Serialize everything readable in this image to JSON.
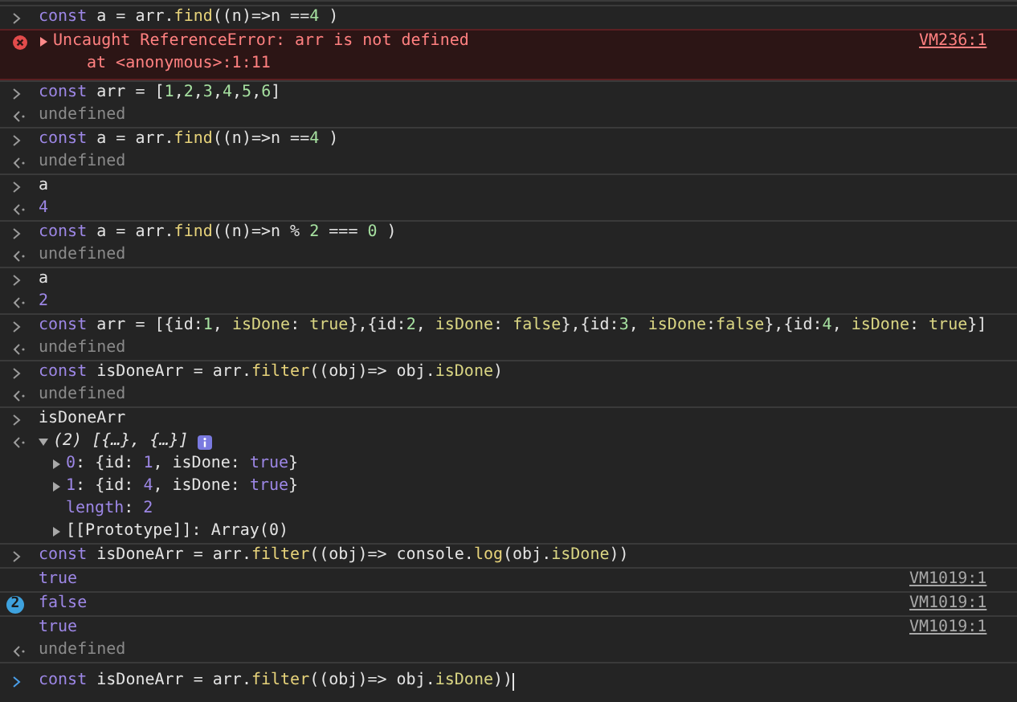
{
  "entries": [
    {
      "kind": "input",
      "tokens": [
        {
          "t": "const",
          "kind": "keyword"
        },
        {
          "t": " a = arr.",
          "kind": "plain"
        },
        {
          "t": "find",
          "kind": "function"
        },
        {
          "t": "((n)=>n ==",
          "kind": "plain"
        },
        {
          "t": "4",
          "kind": "number"
        },
        {
          "t": " )",
          "kind": "plain"
        }
      ]
    },
    {
      "kind": "error",
      "expanded": false,
      "message": "Uncaught ReferenceError: arr is not defined",
      "stack": "at <anonymous>:1:11",
      "source": "VM236:1"
    },
    {
      "kind": "input",
      "tokens": [
        {
          "t": "const",
          "kind": "keyword"
        },
        {
          "t": " arr = [",
          "kind": "plain"
        },
        {
          "t": "1",
          "kind": "number"
        },
        {
          "t": ",",
          "kind": "plain"
        },
        {
          "t": "2",
          "kind": "number"
        },
        {
          "t": ",",
          "kind": "plain"
        },
        {
          "t": "3",
          "kind": "number"
        },
        {
          "t": ",",
          "kind": "plain"
        },
        {
          "t": "4",
          "kind": "number"
        },
        {
          "t": ",",
          "kind": "plain"
        },
        {
          "t": "5",
          "kind": "number"
        },
        {
          "t": ",",
          "kind": "plain"
        },
        {
          "t": "6",
          "kind": "number"
        },
        {
          "t": "]",
          "kind": "plain"
        }
      ]
    },
    {
      "kind": "result",
      "tokens": [
        {
          "t": "undefined",
          "kind": "undefined"
        }
      ]
    },
    {
      "kind": "input",
      "tokens": [
        {
          "t": "const",
          "kind": "keyword"
        },
        {
          "t": " a = arr.",
          "kind": "plain"
        },
        {
          "t": "find",
          "kind": "function"
        },
        {
          "t": "((n)=>n ==",
          "kind": "plain"
        },
        {
          "t": "4",
          "kind": "number"
        },
        {
          "t": " )",
          "kind": "plain"
        }
      ]
    },
    {
      "kind": "result",
      "tokens": [
        {
          "t": "undefined",
          "kind": "undefined"
        }
      ]
    },
    {
      "kind": "input",
      "tokens": [
        {
          "t": "a",
          "kind": "plain"
        }
      ]
    },
    {
      "kind": "result",
      "tokens": [
        {
          "t": "4",
          "kind": "value"
        }
      ]
    },
    {
      "kind": "input",
      "tokens": [
        {
          "t": "const",
          "kind": "keyword"
        },
        {
          "t": " a = arr.",
          "kind": "plain"
        },
        {
          "t": "find",
          "kind": "function"
        },
        {
          "t": "((n)=>n % ",
          "kind": "plain"
        },
        {
          "t": "2",
          "kind": "number"
        },
        {
          "t": " === ",
          "kind": "plain"
        },
        {
          "t": "0",
          "kind": "number"
        },
        {
          "t": " )",
          "kind": "plain"
        }
      ]
    },
    {
      "kind": "result",
      "tokens": [
        {
          "t": "undefined",
          "kind": "undefined"
        }
      ]
    },
    {
      "kind": "input",
      "tokens": [
        {
          "t": "a",
          "kind": "plain"
        }
      ]
    },
    {
      "kind": "result",
      "tokens": [
        {
          "t": "2",
          "kind": "value"
        }
      ]
    },
    {
      "kind": "input",
      "tokens": [
        {
          "t": "const",
          "kind": "keyword"
        },
        {
          "t": " arr = [{id:",
          "kind": "plain"
        },
        {
          "t": "1",
          "kind": "number"
        },
        {
          "t": ", ",
          "kind": "plain"
        },
        {
          "t": "isDone",
          "kind": "property"
        },
        {
          "t": ": ",
          "kind": "plain"
        },
        {
          "t": "true",
          "kind": "boolean"
        },
        {
          "t": "},{id:",
          "kind": "plain"
        },
        {
          "t": "2",
          "kind": "number"
        },
        {
          "t": ", ",
          "kind": "plain"
        },
        {
          "t": "isDone",
          "kind": "property"
        },
        {
          "t": ": ",
          "kind": "plain"
        },
        {
          "t": "false",
          "kind": "boolean"
        },
        {
          "t": "},{id:",
          "kind": "plain"
        },
        {
          "t": "3",
          "kind": "number"
        },
        {
          "t": ", ",
          "kind": "plain"
        },
        {
          "t": "isDone",
          "kind": "property"
        },
        {
          "t": ":",
          "kind": "plain"
        },
        {
          "t": "false",
          "kind": "boolean"
        },
        {
          "t": "},{id:",
          "kind": "plain"
        },
        {
          "t": "4",
          "kind": "number"
        },
        {
          "t": ", ",
          "kind": "plain"
        },
        {
          "t": "isDone",
          "kind": "property"
        },
        {
          "t": ": ",
          "kind": "plain"
        },
        {
          "t": "true",
          "kind": "boolean"
        },
        {
          "t": "}]",
          "kind": "plain"
        }
      ]
    },
    {
      "kind": "result",
      "tokens": [
        {
          "t": "undefined",
          "kind": "undefined"
        }
      ]
    },
    {
      "kind": "input",
      "tokens": [
        {
          "t": "const",
          "kind": "keyword"
        },
        {
          "t": " isDoneArr = arr.",
          "kind": "plain"
        },
        {
          "t": "filter",
          "kind": "function"
        },
        {
          "t": "((obj)=> obj.",
          "kind": "plain"
        },
        {
          "t": "isDone",
          "kind": "property"
        },
        {
          "t": ")",
          "kind": "plain"
        }
      ]
    },
    {
      "kind": "result",
      "tokens": [
        {
          "t": "undefined",
          "kind": "undefined"
        }
      ]
    },
    {
      "kind": "input",
      "tokens": [
        {
          "t": "isDoneArr",
          "kind": "plain"
        }
      ]
    },
    {
      "kind": "object",
      "expanded": true,
      "summary": "(2) [{…}, {…}]",
      "children": [
        {
          "expandable": true,
          "tokens": [
            {
              "t": "0",
              "kind": "value"
            },
            {
              "t": ": {id: ",
              "kind": "plain"
            },
            {
              "t": "1",
              "kind": "value"
            },
            {
              "t": ", isDone: ",
              "kind": "plain"
            },
            {
              "t": "true",
              "kind": "value"
            },
            {
              "t": "}",
              "kind": "plain"
            }
          ]
        },
        {
          "expandable": true,
          "tokens": [
            {
              "t": "1",
              "kind": "value"
            },
            {
              "t": ": {id: ",
              "kind": "plain"
            },
            {
              "t": "4",
              "kind": "value"
            },
            {
              "t": ", isDone: ",
              "kind": "plain"
            },
            {
              "t": "true",
              "kind": "value"
            },
            {
              "t": "}",
              "kind": "plain"
            }
          ]
        },
        {
          "expandable": false,
          "tokens": [
            {
              "t": "length",
              "kind": "value"
            },
            {
              "t": ": ",
              "kind": "plain"
            },
            {
              "t": "2",
              "kind": "value"
            }
          ]
        },
        {
          "expandable": true,
          "tokens": [
            {
              "t": "[[Prototype]]",
              "kind": "plain"
            },
            {
              "t": ": Array(0)",
              "kind": "plain"
            }
          ]
        }
      ]
    },
    {
      "kind": "input",
      "tokens": [
        {
          "t": "const",
          "kind": "keyword"
        },
        {
          "t": " isDoneArr = arr.",
          "kind": "plain"
        },
        {
          "t": "filter",
          "kind": "function"
        },
        {
          "t": "((obj)=> console.",
          "kind": "plain"
        },
        {
          "t": "log",
          "kind": "function"
        },
        {
          "t": "(obj.",
          "kind": "plain"
        },
        {
          "t": "isDone",
          "kind": "property"
        },
        {
          "t": "))",
          "kind": "plain"
        }
      ]
    },
    {
      "kind": "log",
      "text": "true",
      "source": "VM1019:1"
    },
    {
      "kind": "log",
      "count": "2",
      "text": "false",
      "source": "VM1019:1"
    },
    {
      "kind": "log",
      "text": "true",
      "source": "VM1019:1"
    },
    {
      "kind": "result",
      "tokens": [
        {
          "t": "undefined",
          "kind": "undefined"
        }
      ]
    }
  ],
  "prompt": {
    "tokens": [
      {
        "t": "const",
        "kind": "keyword"
      },
      {
        "t": " isDoneArr = arr.",
        "kind": "plain"
      },
      {
        "t": "filter",
        "kind": "function"
      },
      {
        "t": "((obj)=> obj.",
        "kind": "plain"
      },
      {
        "t": "isDone",
        "kind": "property"
      },
      {
        "t": "))",
        "kind": "plain"
      }
    ]
  }
}
